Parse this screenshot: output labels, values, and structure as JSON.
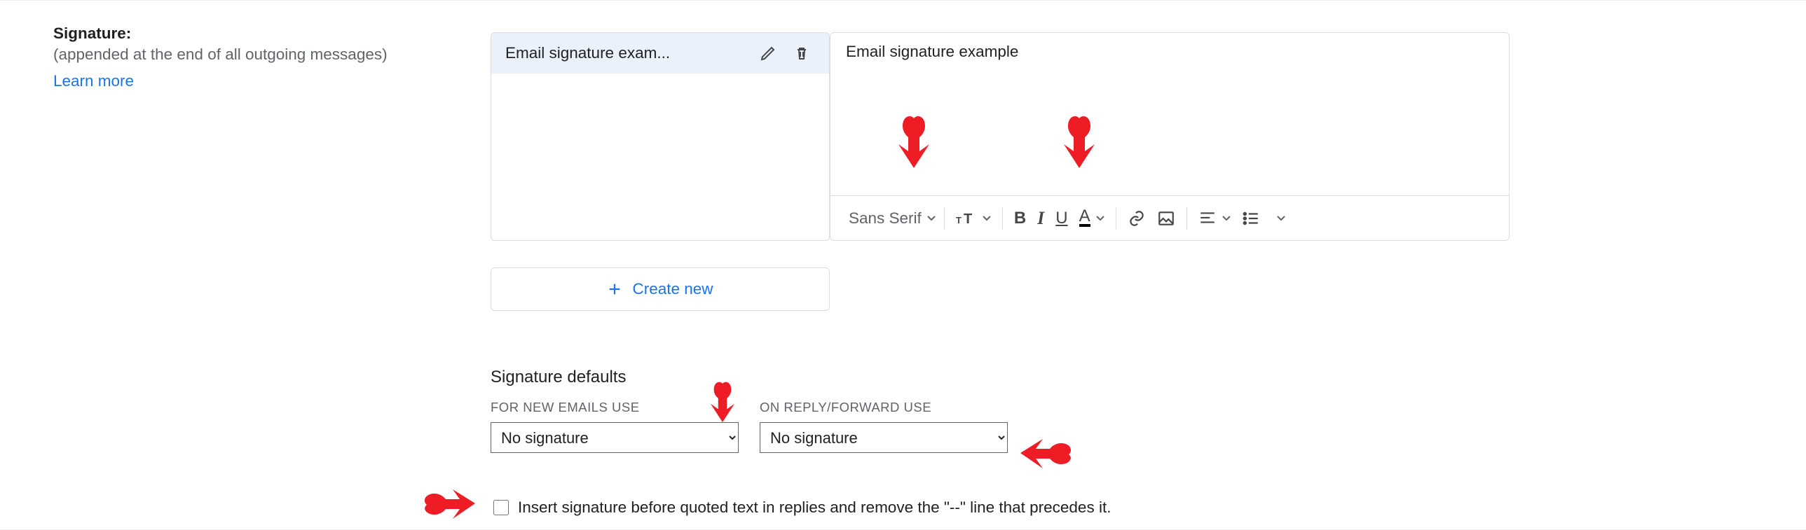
{
  "left": {
    "title": "Signature:",
    "subtitle": "(appended at the end of all outgoing messages)",
    "learn": "Learn more"
  },
  "signatures": {
    "items": [
      {
        "name": "Email signature exam..."
      }
    ]
  },
  "create_label": "Create new",
  "editor": {
    "content": "Email signature example",
    "font_label": "Sans Serif"
  },
  "defaults": {
    "heading": "Signature defaults",
    "for_new_label": "FOR NEW EMAILS USE",
    "on_reply_label": "ON REPLY/FORWARD USE",
    "for_new_value": "No signature",
    "on_reply_value": "No signature"
  },
  "checkbox": {
    "label": "Insert signature before quoted text in replies and remove the \"--\" line that precedes it."
  }
}
